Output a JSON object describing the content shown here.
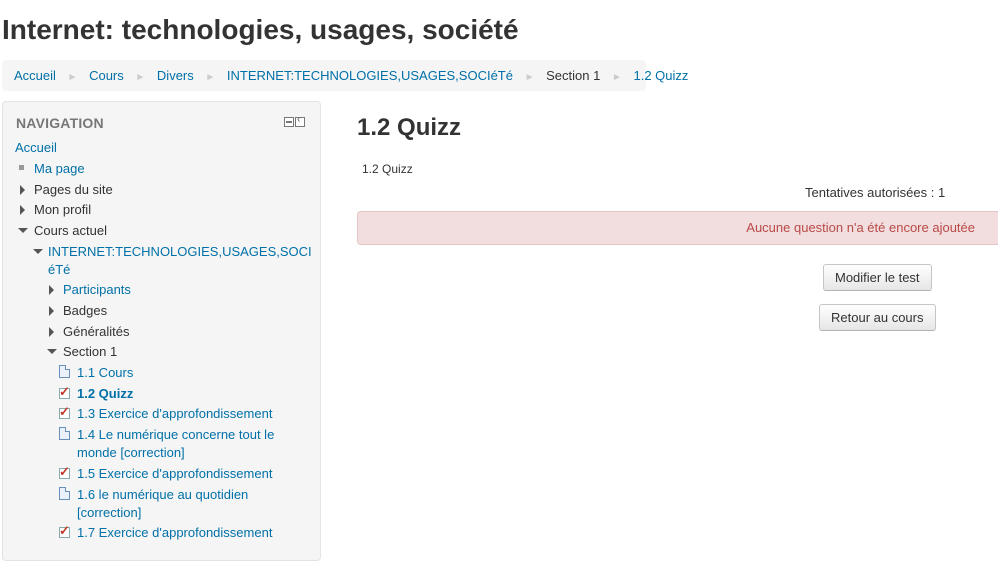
{
  "page": {
    "title": "Internet: technologies, usages, société"
  },
  "breadcrumb": {
    "items": [
      "Accueil",
      "Cours",
      "Divers",
      "INTERNET:TECHNOLOGIES,USAGES,SOCIéTé",
      "Section 1",
      "1.2 Quizz"
    ],
    "separator": "►"
  },
  "navigation": {
    "header": "NAVIGATION",
    "home": "Accueil",
    "my_page": "Ma page",
    "site_pages": "Pages du site",
    "my_profile": "Mon profil",
    "current_course": "Cours actuel",
    "course_name_line1": "INTERNET:TECHNOLOGIES,USAGES,SOCI",
    "course_name_line2": "éTé",
    "participants": "Participants",
    "badges": "Badges",
    "generalites": "Généralités",
    "section1": "Section 1",
    "activities": [
      {
        "label": "1.1 Cours",
        "type": "page"
      },
      {
        "label": "1.2 Quizz",
        "type": "quiz",
        "active": true
      },
      {
        "label": "1.3 Exercice d'approfondissement",
        "type": "quiz"
      },
      {
        "label_line1": "1.4 Le numérique concerne tout le",
        "label_line2": "monde [correction]",
        "type": "page"
      },
      {
        "label": "1.5 Exercice d'approfondissement",
        "type": "quiz"
      },
      {
        "label_line1": "1.6 le numérique au quotidien",
        "label_line2": "[correction]",
        "type": "page"
      },
      {
        "label": "1.7 Exercice d'approfondissement",
        "type": "quiz"
      }
    ]
  },
  "main": {
    "heading": "1.2 Quizz",
    "intro": "1.2 Quizz",
    "attempts": "Tentatives autorisées : 1",
    "alert": "Aucune question n'a été encore ajoutée",
    "edit_button": "Modifier le test",
    "back_button": "Retour au cours"
  },
  "colors": {
    "link": "#0070a8",
    "alert_bg": "#f2dede",
    "alert_text": "#b94a48",
    "quiz_check": "#c0392b"
  },
  "icons": [
    "page-icon",
    "quiz-icon",
    "collapse-arrow-icon",
    "expand-arrow-icon",
    "bullet-icon",
    "minimize-block-icon",
    "dock-block-icon"
  ]
}
